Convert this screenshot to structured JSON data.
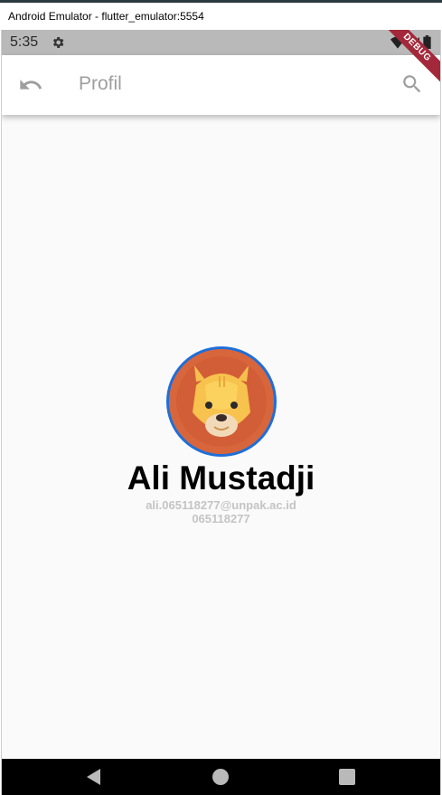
{
  "window": {
    "title": "Android Emulator - flutter_emulator:5554"
  },
  "status_bar": {
    "time": "5:35",
    "icons": [
      "gear-icon",
      "wifi-icon",
      "signal-icon",
      "battery-icon"
    ]
  },
  "debug_banner": {
    "label": "DEBUG"
  },
  "app_bar": {
    "title": "Profil",
    "leading_icon": "undo-icon",
    "action_icon": "search-icon"
  },
  "profile": {
    "name": "Ali Mustadji",
    "email": "ali.065118277@unpak.ac.id",
    "npm": "065118277",
    "avatar_icon": "lion-avatar-icon"
  },
  "nav_bar": {
    "icons": [
      "back-triangle-icon",
      "home-circle-icon",
      "recents-square-icon"
    ]
  },
  "colors": {
    "status_bar_bg": "#b9b9b9",
    "app_bar_bg": "#ffffff",
    "title_color": "#9e9e9e",
    "avatar_border": "#1e6fd9",
    "debug_banner": "#a3283a",
    "secondary_text": "#c4c4c4"
  }
}
